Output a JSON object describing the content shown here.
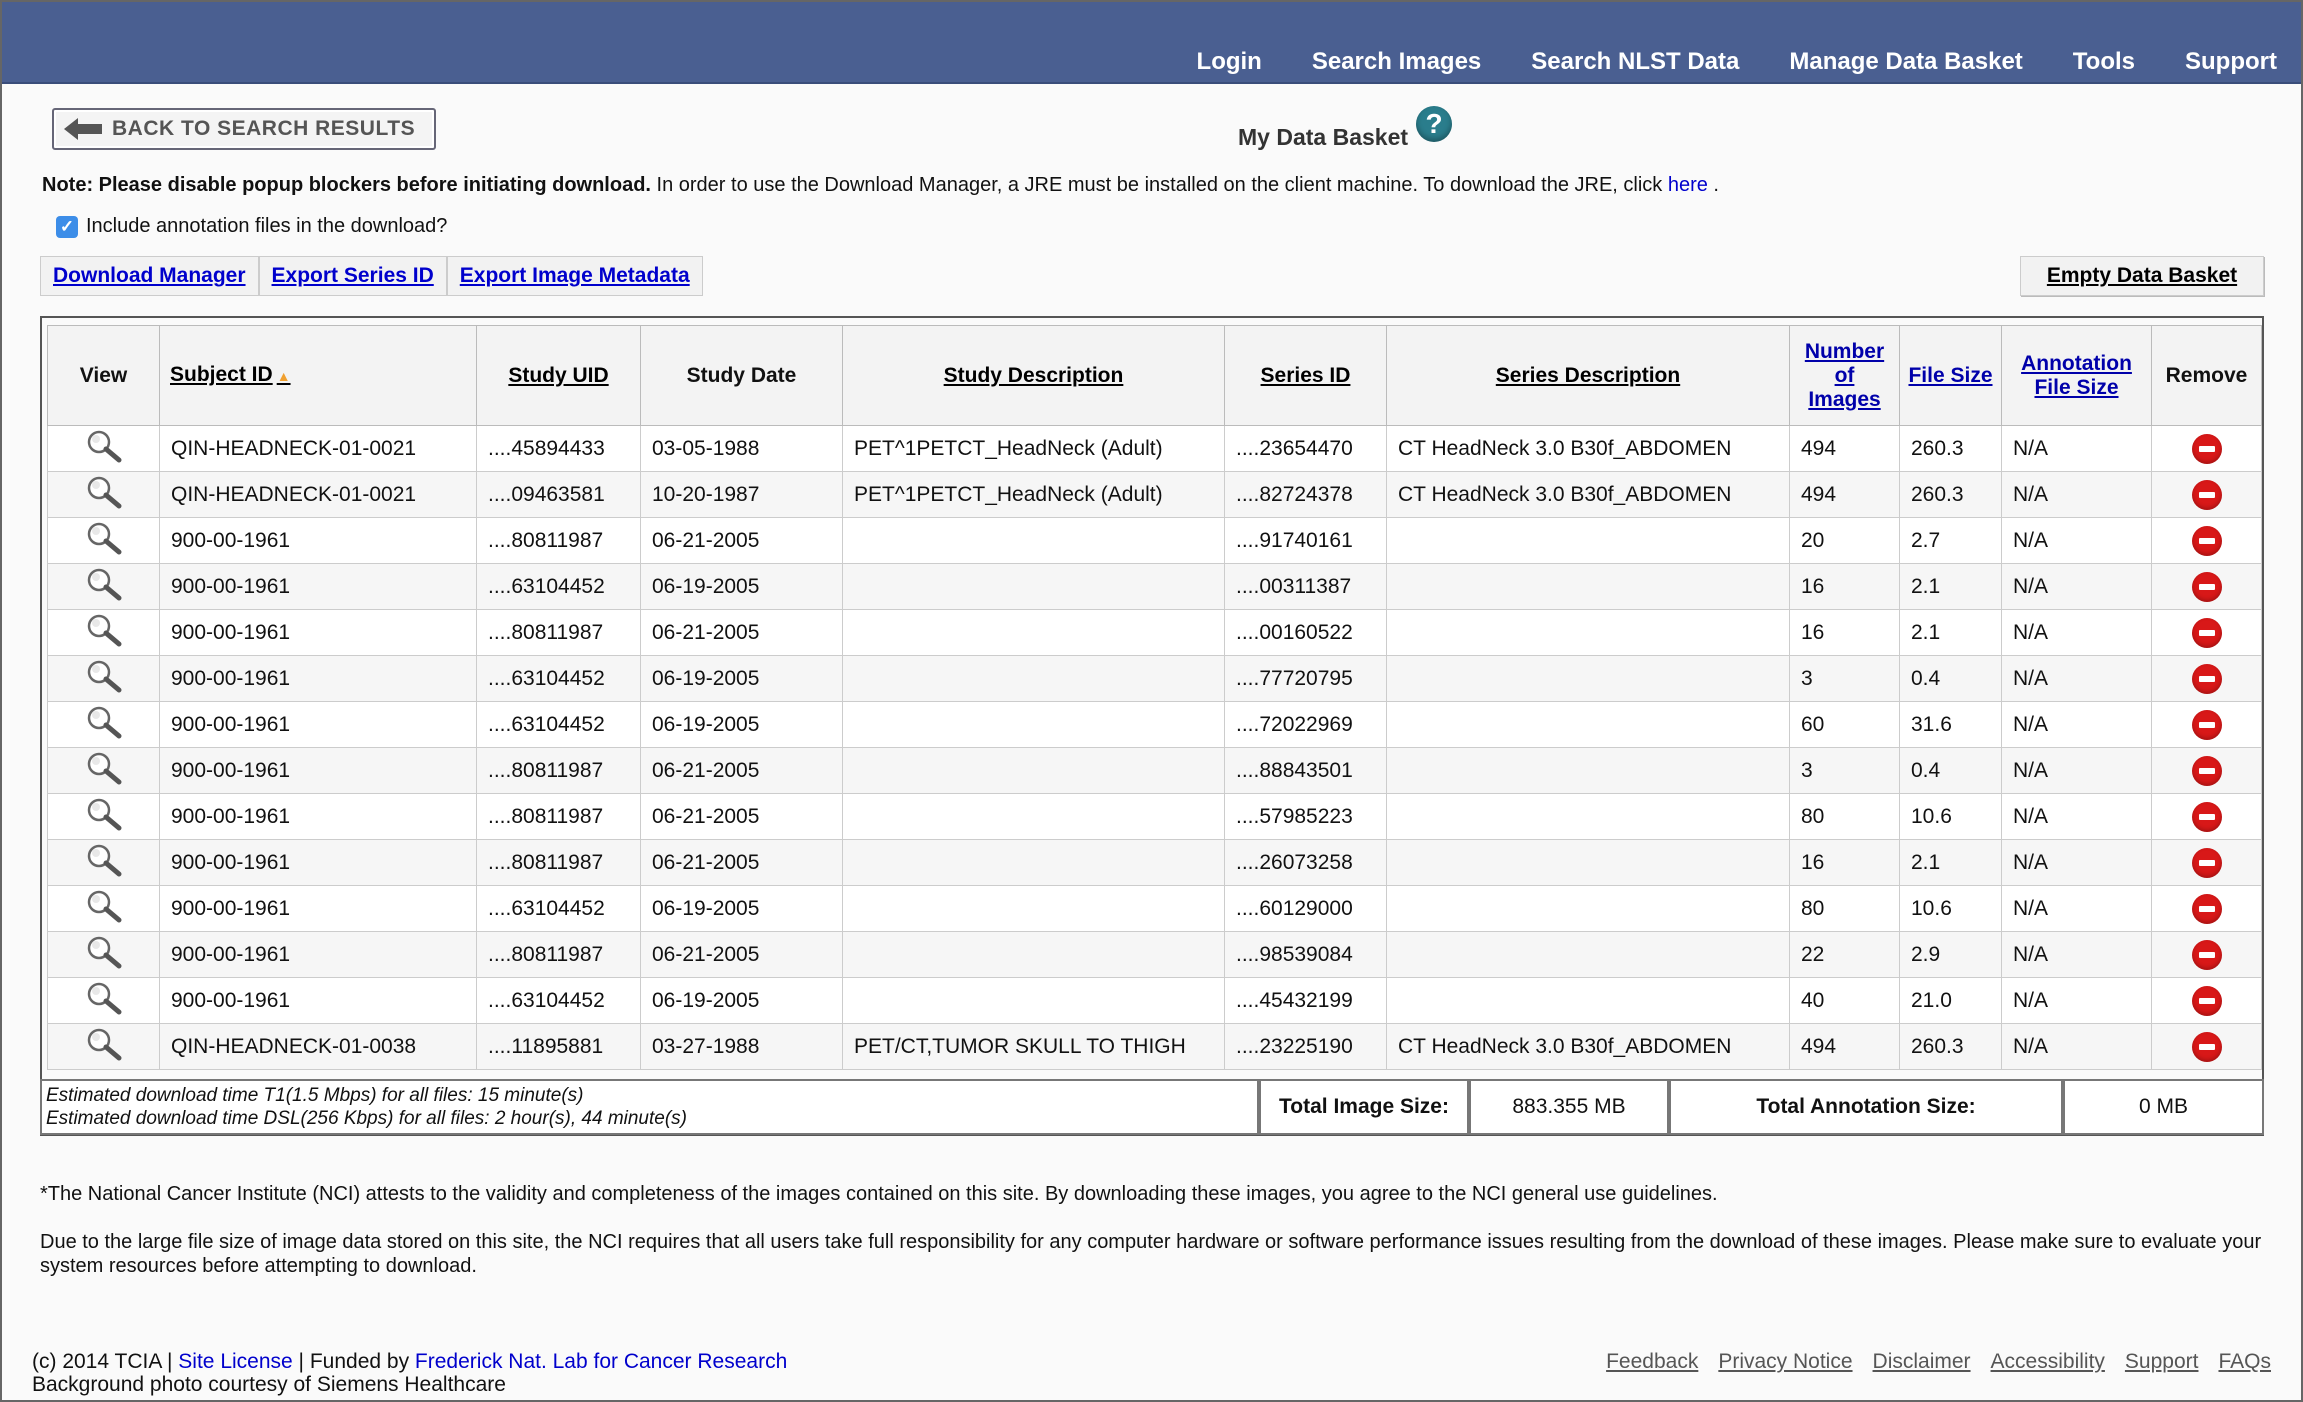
{
  "nav": {
    "items": [
      "Login",
      "Search Images",
      "Search NLST Data",
      "Manage Data Basket",
      "Tools",
      "Support"
    ]
  },
  "back_button": {
    "label": "BACK TO SEARCH RESULTS",
    "icon": "back-arrow-icon"
  },
  "page_title": "My Data Basket",
  "note": {
    "bold": "Note: Please disable popup blockers before initiating download.",
    "text": " In order to use the Download Manager, a JRE must be installed on the client machine. To download the JRE, click ",
    "link": "here",
    "tail": " ."
  },
  "include_annotation": {
    "label": "Include annotation files in the download?",
    "checked": true
  },
  "actions": [
    "Download Manager",
    "Export Series ID",
    "Export Image Metadata"
  ],
  "empty_basket_label": "Empty Data Basket",
  "table": {
    "headers": {
      "view": "View",
      "subject_id": "Subject ID",
      "study_uid": "Study UID",
      "study_date": "Study Date",
      "study_description": "Study Description",
      "series_id": "Series ID",
      "series_description": "Series Description",
      "number_of_images": "Number of Images",
      "file_size": "File Size",
      "annotation_file_size": "Annotation File Size",
      "remove": "Remove"
    },
    "rows": [
      {
        "subject": "QIN-HEADNECK-01-0021",
        "uid": "....45894433",
        "date": "03-05-1988",
        "sdesc": "PET^1PETCT_HeadNeck (Adult)",
        "series": "....23654470",
        "serdesc": "CT HeadNeck 3.0 B30f_ABDOMEN",
        "images": "494",
        "size": "260.3",
        "annot": "N/A"
      },
      {
        "subject": "QIN-HEADNECK-01-0021",
        "uid": "....09463581",
        "date": "10-20-1987",
        "sdesc": "PET^1PETCT_HeadNeck (Adult)",
        "series": "....82724378",
        "serdesc": "CT HeadNeck 3.0 B30f_ABDOMEN",
        "images": "494",
        "size": "260.3",
        "annot": "N/A"
      },
      {
        "subject": "900-00-1961",
        "uid": "....80811987",
        "date": "06-21-2005",
        "sdesc": "",
        "series": "....91740161",
        "serdesc": "",
        "images": "20",
        "size": "2.7",
        "annot": "N/A"
      },
      {
        "subject": "900-00-1961",
        "uid": "....63104452",
        "date": "06-19-2005",
        "sdesc": "",
        "series": "....00311387",
        "serdesc": "",
        "images": "16",
        "size": "2.1",
        "annot": "N/A"
      },
      {
        "subject": "900-00-1961",
        "uid": "....80811987",
        "date": "06-21-2005",
        "sdesc": "",
        "series": "....00160522",
        "serdesc": "",
        "images": "16",
        "size": "2.1",
        "annot": "N/A"
      },
      {
        "subject": "900-00-1961",
        "uid": "....63104452",
        "date": "06-19-2005",
        "sdesc": "",
        "series": "....77720795",
        "serdesc": "",
        "images": "3",
        "size": "0.4",
        "annot": "N/A"
      },
      {
        "subject": "900-00-1961",
        "uid": "....63104452",
        "date": "06-19-2005",
        "sdesc": "",
        "series": "....72022969",
        "serdesc": "",
        "images": "60",
        "size": "31.6",
        "annot": "N/A"
      },
      {
        "subject": "900-00-1961",
        "uid": "....80811987",
        "date": "06-21-2005",
        "sdesc": "",
        "series": "....88843501",
        "serdesc": "",
        "images": "3",
        "size": "0.4",
        "annot": "N/A"
      },
      {
        "subject": "900-00-1961",
        "uid": "....80811987",
        "date": "06-21-2005",
        "sdesc": "",
        "series": "....57985223",
        "serdesc": "",
        "images": "80",
        "size": "10.6",
        "annot": "N/A"
      },
      {
        "subject": "900-00-1961",
        "uid": "....80811987",
        "date": "06-21-2005",
        "sdesc": "",
        "series": "....26073258",
        "serdesc": "",
        "images": "16",
        "size": "2.1",
        "annot": "N/A"
      },
      {
        "subject": "900-00-1961",
        "uid": "....63104452",
        "date": "06-19-2005",
        "sdesc": "",
        "series": "....60129000",
        "serdesc": "",
        "images": "80",
        "size": "10.6",
        "annot": "N/A"
      },
      {
        "subject": "900-00-1961",
        "uid": "....80811987",
        "date": "06-21-2005",
        "sdesc": "",
        "series": "....98539084",
        "serdesc": "",
        "images": "22",
        "size": "2.9",
        "annot": "N/A"
      },
      {
        "subject": "900-00-1961",
        "uid": "....63104452",
        "date": "06-19-2005",
        "sdesc": "",
        "series": "....45432199",
        "serdesc": "",
        "images": "40",
        "size": "21.0",
        "annot": "N/A"
      },
      {
        "subject": "QIN-HEADNECK-01-0038",
        "uid": "....11895881",
        "date": "03-27-1988",
        "sdesc": "PET/CT,TUMOR SKULL TO THIGH",
        "series": "....23225190",
        "serdesc": "CT HeadNeck 3.0 B30f_ABDOMEN",
        "images": "494",
        "size": "260.3",
        "annot": "N/A"
      }
    ]
  },
  "summary": {
    "est_t1": "Estimated download time T1(1.5 Mbps) for all files: 15 minute(s)",
    "est_dsl": "Estimated download time DSL(256 Kbps) for all files: 2 hour(s), 44 minute(s)",
    "total_image_label": "Total Image Size:",
    "total_image_value": "883.355 MB",
    "total_annotation_label": "Total Annotation Size:",
    "total_annotation_value": "0 MB"
  },
  "disclaimer": {
    "p1": "*The National Cancer Institute (NCI) attests to the validity and completeness of the images contained on this site. By downloading these images, you agree to the NCI general use guidelines.",
    "p2": "Due to the large file size of image data stored on this site, the NCI requires that all users take full responsibility for any computer hardware or software performance issues resulting from the download of these images. Please make sure to evaluate your system resources before attempting to download."
  },
  "footer": {
    "copyright": "(c) 2014 TCIA |",
    "site_license": " Site License",
    "funded_by": " | Funded by",
    "frederick": " Frederick Nat. Lab for Cancer Research",
    "photo_credit": "Background photo courtesy of Siemens Healthcare",
    "links": [
      "Feedback",
      "Privacy Notice",
      "Disclaimer",
      "Accessibility",
      "Support",
      "FAQs"
    ]
  },
  "colors": {
    "topbar": "#4a5f91",
    "link": "#0000cc",
    "remove": "#d81818",
    "help": "#2a7d8c",
    "checkbox": "#3c8de8"
  }
}
